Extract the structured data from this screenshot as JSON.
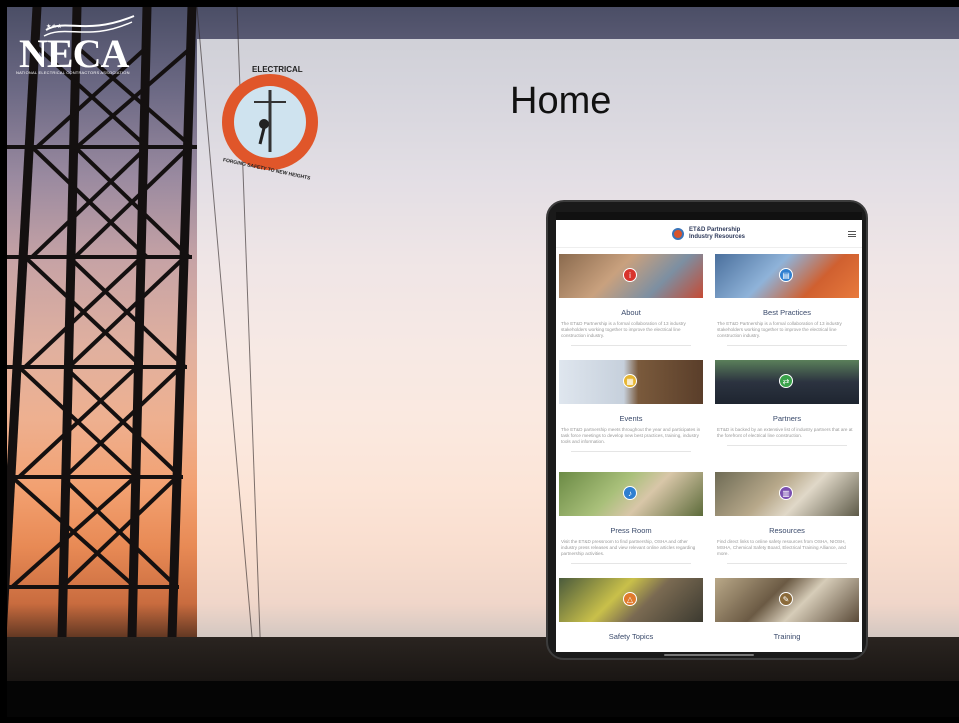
{
  "slide": {
    "title": "Home"
  },
  "neca_logo": {
    "wordmark": "NECA",
    "tagline": "NATIONAL ELECTRICAL CONTRACTORS ASSOCIATION"
  },
  "partnership_badge": {
    "top_text": "ELECTRICAL",
    "ring_text": "TRANSMISSION & DISTRIBUTION PARTNERSHIP",
    "bottom_text": "FORGING SAFETY TO NEW HEIGHTS"
  },
  "app": {
    "title_line1": "ET&D Partnership",
    "title_line2": "Industry Resources",
    "cards": [
      {
        "title": "About",
        "desc": "The ET&D Partnership is a formal collaboration of 13 industry stakeholders working together to improve the electrical line construction industry.",
        "icon": "info-icon",
        "color": "#d8342c"
      },
      {
        "title": "Best Practices",
        "desc": "The ET&D Partnership is a formal collaboration of 13 industry stakeholders working together to improve the electrical line construction industry.",
        "icon": "clipboard-icon",
        "color": "#2f7fd0"
      },
      {
        "title": "Events",
        "desc": "The ET&D partnership meets throughout the year and participates in task force meetings to develop new best practices, training, industry tools and information.",
        "icon": "calendar-icon",
        "color": "#e5b532"
      },
      {
        "title": "Partners",
        "desc": "ET&D is backed by an extensive list of industry partners that are at the forefront of electrical line construction.",
        "icon": "handshake-icon",
        "color": "#3aa24a"
      },
      {
        "title": "Press Room",
        "desc": "Visit the ET&D pressroom to find partnership, OSHA and other industry press releases and view relevant online articles regarding partnership activities.",
        "icon": "microphone-icon",
        "color": "#2f7fd0"
      },
      {
        "title": "Resources",
        "desc": "Find direct links to online safety resources from OSHA, NIOSH, MSHA, Chemical Safety Board, Electrical Training Alliance, and more.",
        "icon": "book-icon",
        "color": "#7a4fb0"
      },
      {
        "title": "Safety Topics",
        "desc": "",
        "icon": "warning-icon",
        "color": "#e07a2c"
      },
      {
        "title": "Training",
        "desc": "",
        "icon": "pencil-icon",
        "color": "#8a6a3a"
      }
    ]
  }
}
